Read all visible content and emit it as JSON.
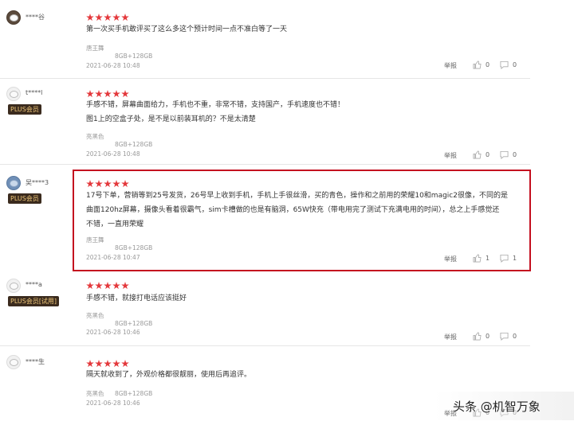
{
  "reviews": [
    {
      "user": "****谷",
      "badge": "",
      "lines": [
        "第一次买手机敢评买了这么多这个预计时间一点不准白等了一天"
      ],
      "color": "唐王舞",
      "spec": "8GB+128GB",
      "date": "2021-06-28 10:48",
      "report": "举报",
      "likes": "0",
      "replies": "0"
    },
    {
      "user": "t****l",
      "badge": "PLUS会员",
      "lines": [
        "手感不错，屏幕曲面给力，手机也不重，非常不错，支持国产，手机速度也不错！",
        "图1上的空盒子处，是不是以前装耳机的？不是太清楚"
      ],
      "color": "亮黑色",
      "spec": "8GB+128GB",
      "date": "2021-06-28 10:48",
      "report": "举报",
      "likes": "0",
      "replies": "0"
    },
    {
      "user": "吴****3",
      "badge": "PLUS会员",
      "lines": [
        "17号下单，营销等到25号发货，26号早上收到手机，手机上手很丝滑，买的青色，操作和之前用的荣耀10和magic2很像，不同的是",
        "曲面120hz屏幕，摄像头看着很霸气，sim卡槽做的也是有脑洞，65W快充（带电用完了测试下充满电用的时间），总之上手感觉还",
        "不错，一直用荣耀"
      ],
      "color": "唐王舞",
      "spec": "8GB+128GB",
      "date": "2021-06-28 10:47",
      "report": "举报",
      "likes": "1",
      "replies": "1"
    },
    {
      "user": "****a",
      "badge": "PLUS会员[试用]",
      "lines": [
        "手感不错，就接打电话应该挺好"
      ],
      "color": "亮黑色",
      "spec": "8GB+128GB",
      "date": "2021-06-28 10:46",
      "report": "举报",
      "likes": "0",
      "replies": "0"
    },
    {
      "user": "****生",
      "badge": "",
      "lines": [
        "隔天就收到了，外观价格都很靓丽，使用后再追评。"
      ],
      "color": "亮黑色",
      "spec": "8GB+128GB",
      "date": "2021-06-28 10:46",
      "report": "举报",
      "likes": "0",
      "replies": "0"
    }
  ],
  "watermark": "头条 @机智万象",
  "colors": {
    "star": "#e4393c",
    "highlight": "#c40f1f",
    "plus_bg": "#3b2b1e",
    "plus_text": "#f0c87a"
  }
}
